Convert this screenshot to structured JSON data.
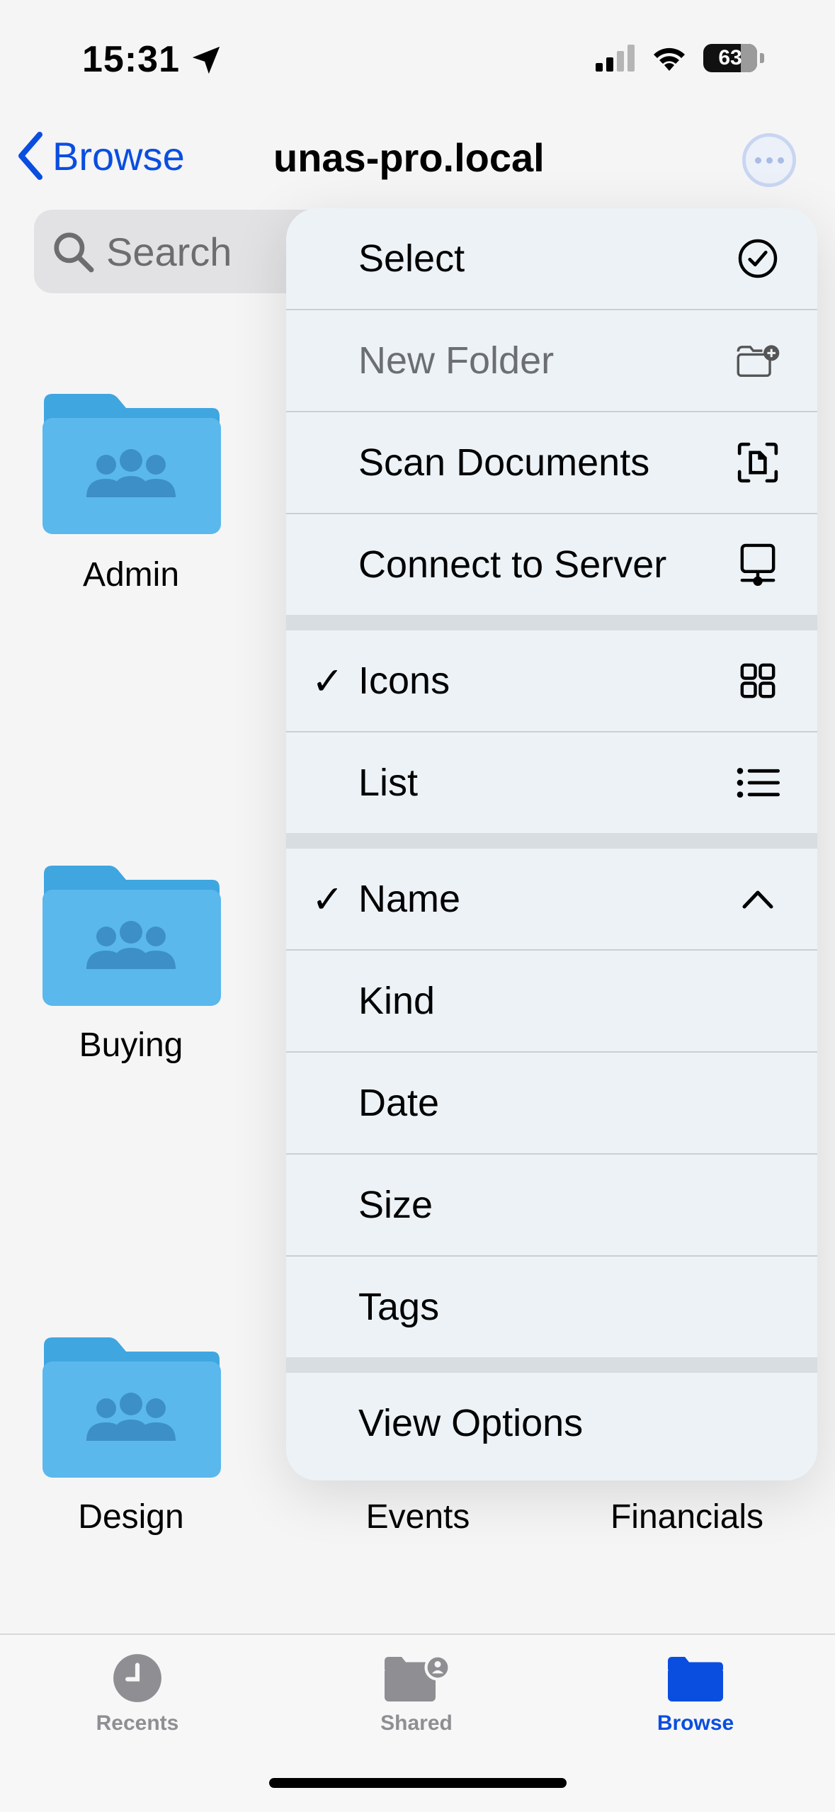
{
  "status": {
    "time": "15:31",
    "battery": "63"
  },
  "nav": {
    "back_label": "Browse",
    "title": "unas-pro.local"
  },
  "search": {
    "placeholder": "Search"
  },
  "folders": [
    {
      "name": "Admin"
    },
    {
      "name": "Buying"
    },
    {
      "name": "Design"
    },
    {
      "name": "Events"
    },
    {
      "name": "Financials"
    }
  ],
  "menu": {
    "actions": [
      {
        "label": "Select",
        "icon": "checkmark-circle-icon",
        "disabled": false
      },
      {
        "label": "New Folder",
        "icon": "folder-badge-plus-icon",
        "disabled": true
      },
      {
        "label": "Scan Documents",
        "icon": "doc-viewfinder-icon",
        "disabled": false
      },
      {
        "label": "Connect to Server",
        "icon": "display-server-icon",
        "disabled": false
      }
    ],
    "views": [
      {
        "label": "Icons",
        "icon": "grid-icon",
        "checked": true
      },
      {
        "label": "List",
        "icon": "list-icon",
        "checked": false
      }
    ],
    "sort": [
      {
        "label": "Name",
        "checked": true,
        "icon": "chevron-up-icon"
      },
      {
        "label": "Kind",
        "checked": false
      },
      {
        "label": "Date",
        "checked": false
      },
      {
        "label": "Size",
        "checked": false
      },
      {
        "label": "Tags",
        "checked": false
      }
    ],
    "view_options_label": "View Options",
    "checkmark": "✓"
  },
  "tabs": [
    {
      "label": "Recents",
      "icon": "clock-icon",
      "active": false
    },
    {
      "label": "Shared",
      "icon": "shared-folder-icon",
      "active": false
    },
    {
      "label": "Browse",
      "icon": "folder-icon",
      "active": true
    }
  ],
  "colors": {
    "accent": "#0a4ee0",
    "folder": "#5ab8ec",
    "menu_bg": "#ecf2f6"
  }
}
